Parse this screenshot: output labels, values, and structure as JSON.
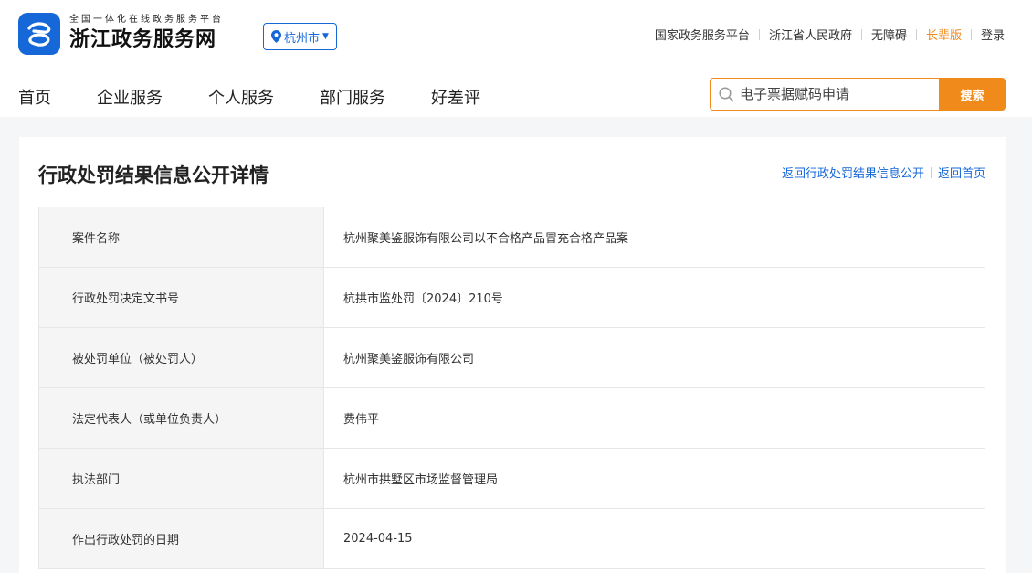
{
  "header": {
    "logo_subtitle": "全国一体化在线政务服务平台",
    "logo_title": "浙江政务服务网",
    "city": "杭州市",
    "links": [
      "国家政务服务平台",
      "浙江省人民政府",
      "无障碍",
      "长辈版",
      "登录"
    ]
  },
  "nav": [
    "首页",
    "企业服务",
    "个人服务",
    "部门服务",
    "好差评"
  ],
  "search": {
    "placeholder": "电子票据赋码申请",
    "button": "搜索"
  },
  "page": {
    "title": "行政处罚结果信息公开详情",
    "crumbs": [
      "返回行政处罚结果信息公开",
      "返回首页"
    ]
  },
  "rows": [
    {
      "label": "案件名称",
      "value": "杭州聚美鉴服饰有限公司以不合格产品冒充合格产品案"
    },
    {
      "label": "行政处罚决定文书号",
      "value": "杭拱市监处罚〔2024〕210号"
    },
    {
      "label": "被处罚单位（被处罚人）",
      "value": "杭州聚美鉴服饰有限公司"
    },
    {
      "label": "法定代表人（或单位负责人）",
      "value": "费伟平"
    },
    {
      "label": "执法部门",
      "value": "杭州市拱墅区市场监督管理局"
    },
    {
      "label": "作出行政处罚的日期",
      "value": "2024-04-15"
    }
  ],
  "icons": {
    "logo": "zhejiang-logo-icon",
    "location": "location-pin-icon",
    "caret": "caret-down-icon",
    "search": "search-icon"
  },
  "colors": {
    "brand_blue": "#1667d8",
    "accent_orange": "#f08a1b"
  }
}
